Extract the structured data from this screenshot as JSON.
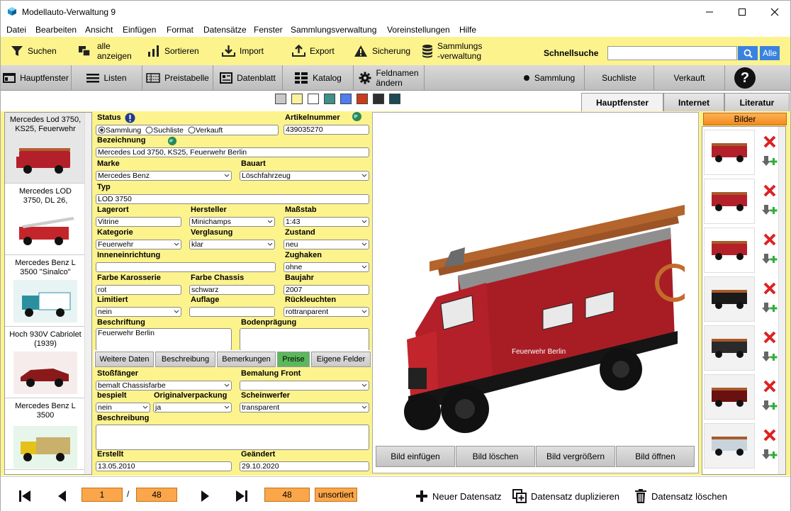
{
  "window": {
    "title": "Modellauto-Verwaltung 9"
  },
  "menu": [
    "Datei",
    "Bearbeiten",
    "Ansicht",
    "Einfügen",
    "Format",
    "Datensätze",
    "Fenster",
    "Sammlungsverwaltung",
    "Voreinstellungen",
    "Hilfe"
  ],
  "toolbar": {
    "suchen": "Suchen",
    "alle1": "alle",
    "alle2": "anzeigen",
    "sortieren": "Sortieren",
    "import": "Import",
    "export": "Export",
    "sicherung": "Sicherung",
    "sammlung1": "Sammlungs",
    "sammlung2": "-verwaltung",
    "schnellsuche": "Schnellsuche",
    "search_value": "",
    "alle_btn": "Alle"
  },
  "toolbar2": {
    "hauptfenster": "Hauptfenster",
    "listen": "Listen",
    "preistabelle": "Preistabelle",
    "datenblatt": "Datenblatt",
    "katalog": "Katalog",
    "feldnamen1": "Feldnamen",
    "feldnamen2": "ändern",
    "sammlung": "Sammlung",
    "suchliste": "Suchliste",
    "verkauft": "Verkauft",
    "help": "?"
  },
  "swatch_colors": [
    "#c8c8c8",
    "#fbf2a0",
    "#ffffff",
    "#3f8f8a",
    "#4f7df0",
    "#c83c1c",
    "#2e2e2e",
    "#1f4a55"
  ],
  "right_tabs": [
    "Hauptfenster",
    "Internet",
    "Literatur"
  ],
  "list": [
    {
      "title": "Mercedes Lod 3750, KS25, Feuerwehr"
    },
    {
      "title": "Mercedes LOD 3750, DL 26,"
    },
    {
      "title": "Mercedes Benz L 3500 \"Sinalco\""
    },
    {
      "title": "Hoch 930V Cabriolet (1939)"
    },
    {
      "title": "Mercedes Benz L 3500"
    }
  ],
  "form": {
    "status_label": "Status",
    "status_options": [
      "Sammlung",
      "Suchliste",
      "Verkauft"
    ],
    "artikelnummer_label": "Artikelnummer",
    "artikelnummer": "439035270",
    "bezeichnung_label": "Bezeichnung",
    "bezeichnung": "Mercedes Lod 3750, KS25, Feuerwehr Berlin",
    "marke_label": "Marke",
    "marke": "Mercedes Benz",
    "bauart_label": "Bauart",
    "bauart": "Löschfahrzeug",
    "typ_label": "Typ",
    "typ": "LOD 3750",
    "lagerort_label": "Lagerort",
    "lagerort": "Vitrine",
    "hersteller_label": "Hersteller",
    "hersteller": "Minichamps",
    "massstab_label": "Maßstab",
    "massstab": "1:43",
    "kategorie_label": "Kategorie",
    "kategorie": "Feuerwehr",
    "verglasung_label": "Verglasung",
    "verglasung": "klar",
    "zustand_label": "Zustand",
    "zustand": "neu",
    "inneneinrichtung_label": "Inneneinrichtung",
    "inneneinrichtung": "",
    "zughaken_label": "Zughaken",
    "zughaken": "ohne",
    "farbe_karosserie_label": "Farbe Karosserie",
    "farbe_karosserie": "rot",
    "farbe_chassis_label": "Farbe Chassis",
    "farbe_chassis": "schwarz",
    "baujahr_label": "Baujahr",
    "baujahr": "2007",
    "limitiert_label": "Limitiert",
    "limitiert": "nein",
    "auflage_label": "Auflage",
    "auflage": "",
    "rueckleuchten_label": "Rückleuchten",
    "rueckleuchten": "rottranparent",
    "beschriftung_label": "Beschriftung",
    "beschriftung": "Feuerwehr Berlin",
    "bodenpraegung_label": "Bodenprägung",
    "bodenpraegung": ""
  },
  "subtabs": [
    "Weitere Daten",
    "Beschreibung",
    "Bemerkungen",
    "Preise",
    "Eigene Felder"
  ],
  "form2": {
    "stossfaenger_label": "Stoßfänger",
    "stossfaenger": "bemalt Chassisfarbe",
    "bemalung_front_label": "Bemalung Front",
    "bemalung_front": "",
    "bespielt_label": "bespielt",
    "bespielt": "nein",
    "originalverpackung_label": "Originalverpackung",
    "originalverpackung": "ja",
    "scheinwerfer_label": "Scheinwerfer",
    "scheinwerfer": "transparent",
    "beschreibung_label": "Beschreibung",
    "beschreibung": "",
    "erstellt_label": "Erstellt",
    "erstellt": "13.05.2010",
    "geaendert_label": "Geändert",
    "geaendert": "29.10.2020"
  },
  "image_buttons": [
    "Bild einfügen",
    "Bild löschen",
    "Bild vergrößern",
    "Bild öffnen"
  ],
  "vehicle_text": "Feuerwehr Berlin",
  "thumbs_header": "Bilder",
  "bottom": {
    "current": "1",
    "separator": "/",
    "total": "48",
    "count": "48",
    "sort": "unsortiert",
    "neu": "Neuer Datensatz",
    "dup": "Datensatz duplizieren",
    "del": "Datensatz löschen"
  }
}
